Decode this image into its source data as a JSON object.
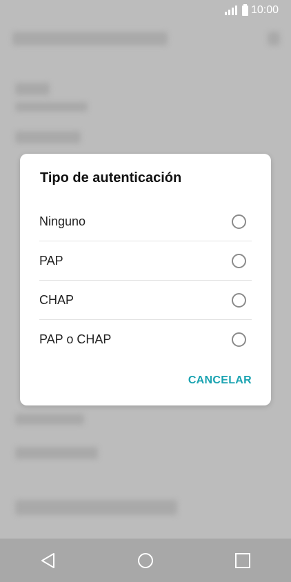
{
  "status_bar": {
    "time": "10:00"
  },
  "dialog": {
    "title": "Tipo de autenticación",
    "options": [
      {
        "label": "Ninguno",
        "selected": false
      },
      {
        "label": "PAP",
        "selected": false
      },
      {
        "label": "CHAP",
        "selected": false
      },
      {
        "label": "PAP o CHAP",
        "selected": false
      }
    ],
    "cancel_label": "CANCELAR"
  },
  "nav_bar": {
    "back": "back-icon",
    "home": "home-icon",
    "recents": "recents-icon"
  },
  "colors": {
    "accent": "#1aa3b1",
    "scrim": "#bcbcbc"
  }
}
